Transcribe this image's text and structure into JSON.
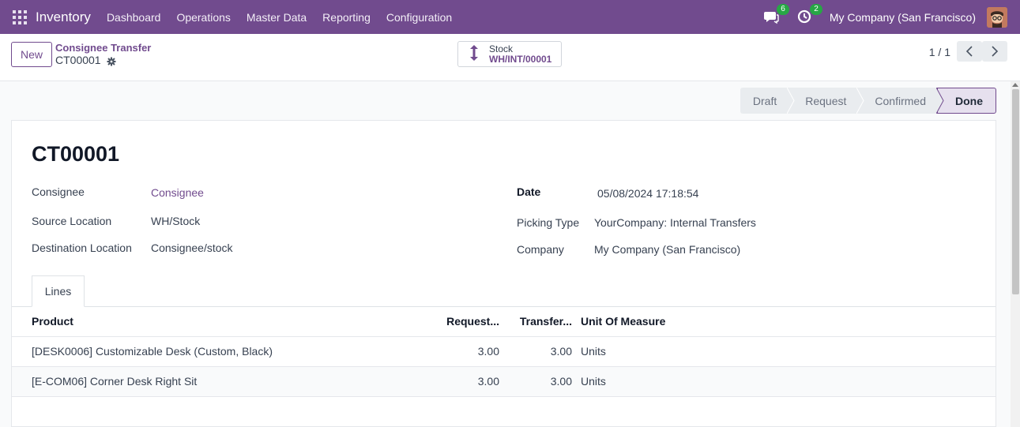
{
  "navbar": {
    "app_name": "Inventory",
    "menu": [
      "Dashboard",
      "Operations",
      "Master Data",
      "Reporting",
      "Configuration"
    ],
    "messages_count": "6",
    "activities_count": "2",
    "company": "My Company (San Francisco)",
    "color": "#714b8e"
  },
  "control_panel": {
    "new_label": "New",
    "breadcrumb": "Consignee Transfer",
    "record": "CT00001",
    "smart_button": {
      "label": "Stock",
      "value": "WH/INT/00001"
    },
    "pager": "1 / 1"
  },
  "status": {
    "stages": [
      "Draft",
      "Request",
      "Confirmed",
      "Done"
    ],
    "current": "Done"
  },
  "form": {
    "title": "CT00001",
    "left": {
      "consignee_label": "Consignee",
      "consignee_value": "Consignee",
      "source_label": "Source Location",
      "source_value": "WH/Stock",
      "dest_label": "Destination Location",
      "dest_value": "Consignee/stock"
    },
    "right": {
      "date_label": "Date",
      "date_value": "05/08/2024 17:18:54",
      "picking_label": "Picking Type",
      "picking_value": "YourCompany: Internal Transfers",
      "company_label": "Company",
      "company_value": "My Company (San Francisco)"
    },
    "tab": "Lines",
    "table": {
      "headers": [
        "Product",
        "Request...",
        "Transfer...",
        "Unit Of Measure"
      ],
      "rows": [
        [
          "[DESK0006] Customizable Desk (Custom, Black)",
          "3.00",
          "3.00",
          "Units"
        ],
        [
          "[E-COM06] Corner Desk Right Sit",
          "3.00",
          "3.00",
          "Units"
        ]
      ]
    }
  }
}
